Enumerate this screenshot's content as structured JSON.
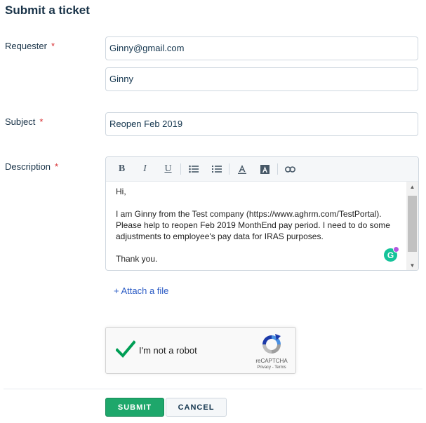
{
  "page": {
    "title": "Submit a ticket"
  },
  "requester": {
    "label": "Requester",
    "required_mark": "*",
    "email_value": "Ginny@gmail.com",
    "name_value": "Ginny"
  },
  "subject": {
    "label": "Subject",
    "required_mark": "*",
    "value": "Reopen Feb 2019"
  },
  "description": {
    "label": "Description",
    "required_mark": "*",
    "toolbar": {
      "bold": "B",
      "italic": "I",
      "underline": "U",
      "icons": [
        "bullet-list-icon",
        "numbered-list-icon",
        "font-color-icon",
        "background-color-icon",
        "link-icon"
      ]
    },
    "body": {
      "greeting": "Hi,",
      "line1": "I am Ginny from the Test company (https://www.aghrm.com/TestPortal).",
      "line2": "Please help to reopen Feb 2019 MonthEnd pay period. I need to do some",
      "line3": "adjustments to employee's pay data for IRAS purposes.",
      "closing": "Thank you."
    },
    "grammarly_letter": "G"
  },
  "attach": {
    "label": "+ Attach a file"
  },
  "captcha": {
    "label": "I'm not a robot",
    "brand": "reCAPTCHA",
    "links": "Privacy - Terms"
  },
  "actions": {
    "submit_label": "SUBMIT",
    "cancel_label": "CANCEL"
  },
  "colors": {
    "accent": "#1ea76b",
    "link": "#2c5cc5",
    "required": "#d72d30"
  }
}
